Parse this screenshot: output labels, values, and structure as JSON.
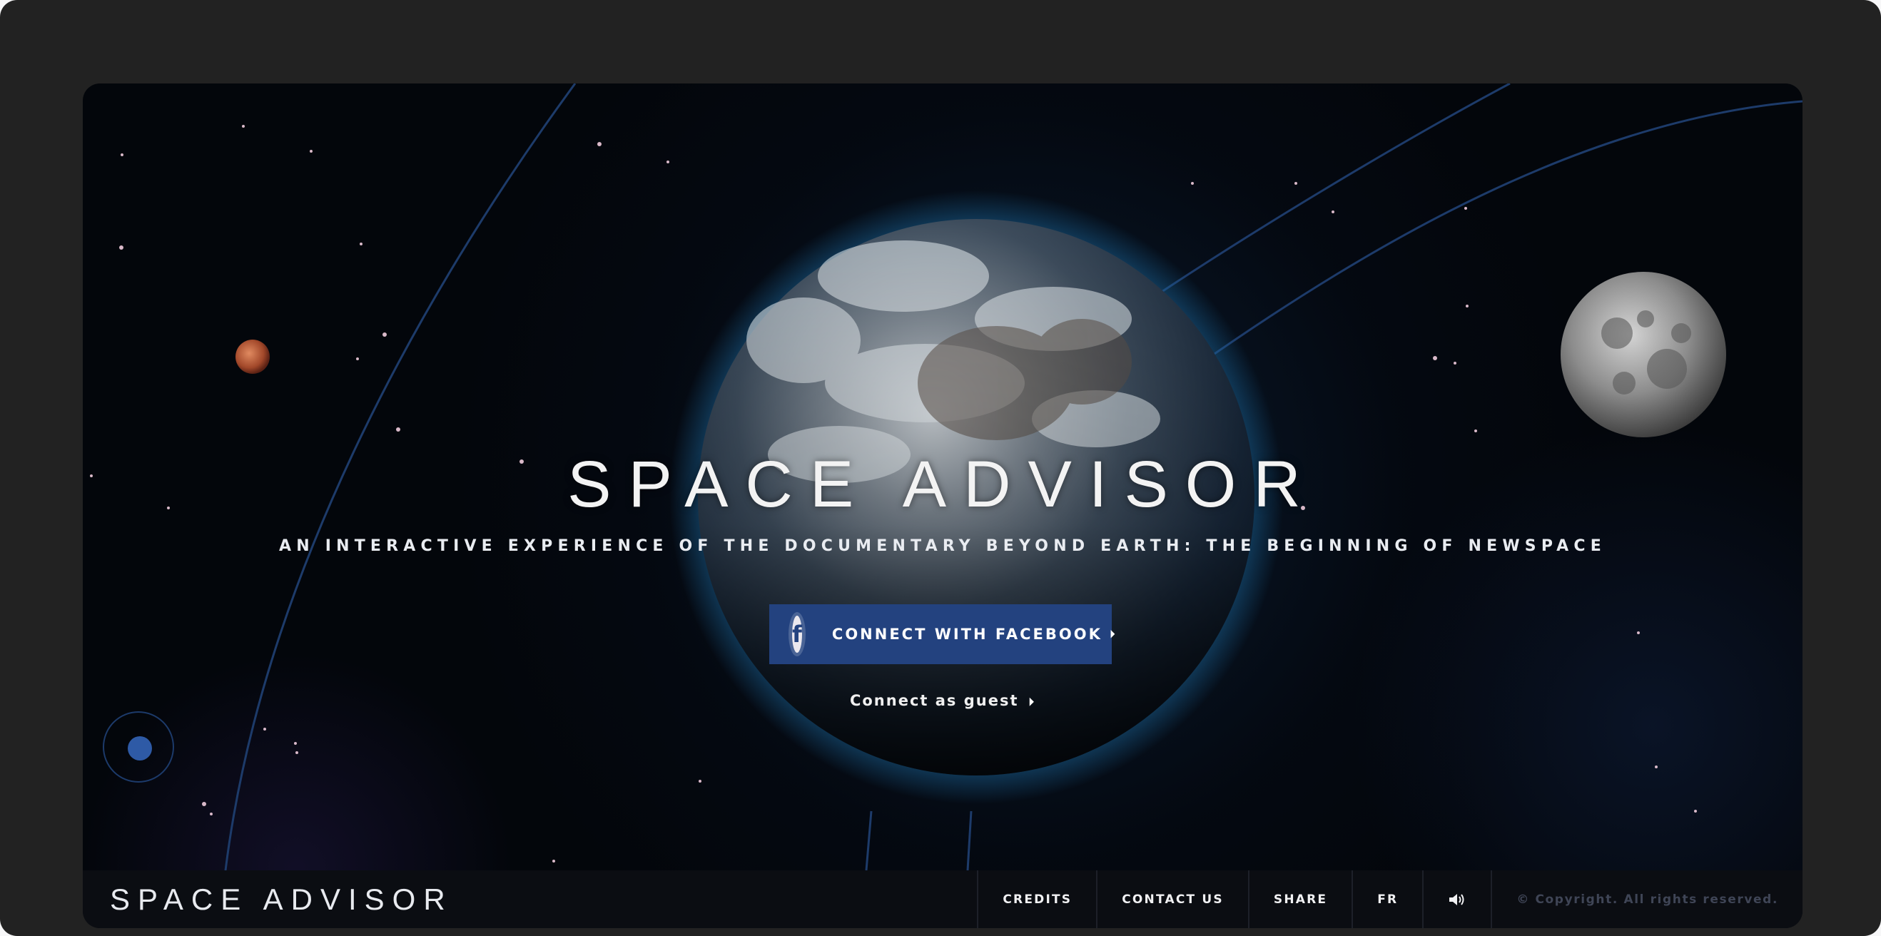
{
  "hero": {
    "title": "SPACE ADVISOR",
    "subtitle": "AN INTERACTIVE EXPERIENCE OF THE DOCUMENTARY BEYOND EARTH: THE BEGINNING OF NEWSPACE",
    "facebook_icon_letter": "f",
    "facebook_label": "CONNECT WITH FACEBOOK",
    "play_glyph": "⏵",
    "guest_label": "Connect as guest"
  },
  "footer": {
    "logo": "SPACE ADVISOR",
    "credits": "CREDITS",
    "contact": "CONTACT US",
    "share": "SHARE",
    "language": "FR",
    "sound_icon": "speaker-icon",
    "copyright": "© Copyright. All rights reserved."
  },
  "colors": {
    "facebook_button": "#23427f",
    "nav_dot": "#2e5aa6",
    "footer_bg": "#0b0d12",
    "copyright_text": "#3f4556"
  }
}
